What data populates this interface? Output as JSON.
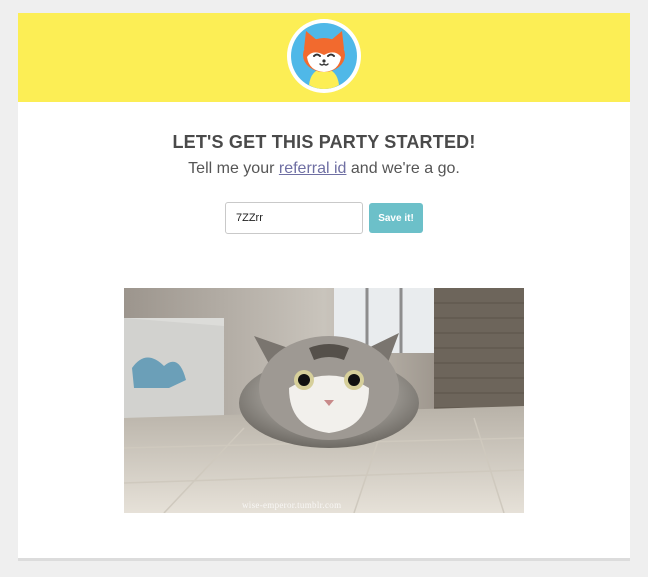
{
  "header": {
    "logo_icon": "fox-mascot-icon",
    "background": "#fcee55"
  },
  "heading": {
    "title": "LET'S GET THIS PARTY STARTED!"
  },
  "message": {
    "prefix": "Tell me your ",
    "link_text": "referral id",
    "suffix": " and we're a go."
  },
  "form": {
    "referral_value": "7ZZrr",
    "save_label": "Save it!",
    "button_color": "#6cc0c9"
  },
  "media": {
    "description_icon": "cat-photo",
    "watermark": "wise-emperor.tumblr.com"
  }
}
